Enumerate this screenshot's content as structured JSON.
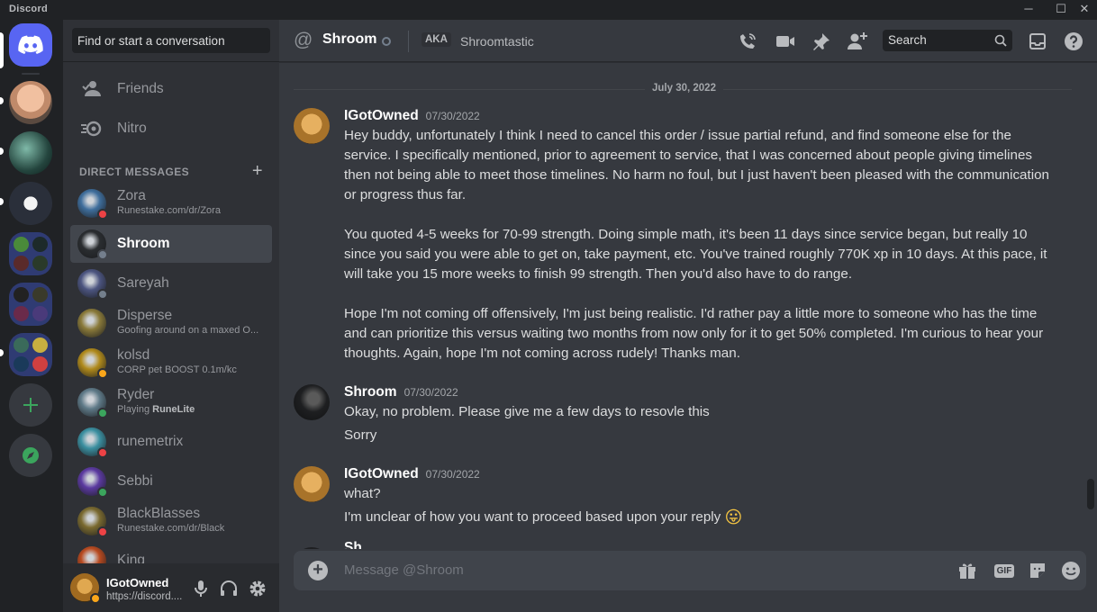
{
  "titlebar": {
    "brand": "Discord",
    "minimize": "─",
    "maximize": "☐",
    "close": "✕"
  },
  "sidebar": {
    "search_placeholder": "Find or start a conversation",
    "nav": [
      {
        "label": "Friends"
      },
      {
        "label": "Nitro"
      }
    ],
    "dm_header": "DIRECT MESSAGES",
    "dm_add": "+",
    "dms": [
      {
        "name": "Zora",
        "sub": "Runestake.com/dr/Zora",
        "status": "dnd",
        "color": "#3f6e9c"
      },
      {
        "name": "Shroom",
        "sub": "",
        "status": "offline",
        "color": "#2a2d30",
        "active": true
      },
      {
        "name": "Sareyah",
        "sub": "",
        "status": "offline",
        "color": "#4c5580"
      },
      {
        "name": "Disperse",
        "sub": "Goofing around on a maxed O...",
        "status": "none",
        "color": "#8a7a3a"
      },
      {
        "name": "kolsd",
        "sub": "CORP pet BOOST 0.1m/kc",
        "status": "idle",
        "color": "#b08a1c"
      },
      {
        "name": "Ryder",
        "sub_prefix": "Playing ",
        "sub_bold": "RuneLite",
        "status": "online",
        "color": "#5f7a88"
      },
      {
        "name": "runemetrix",
        "sub": "",
        "status": "dnd",
        "color": "#3b8fa0"
      },
      {
        "name": "Sebbi",
        "sub": "",
        "status": "online",
        "color": "#5b3aa0"
      },
      {
        "name": "BlackBlasses",
        "sub": "Runestake.com/dr/Black",
        "status": "dnd",
        "color": "#7a6a30"
      },
      {
        "name": "King",
        "sub": "",
        "status": "none",
        "color": "#b84a20"
      }
    ]
  },
  "user": {
    "name": "IGotOwned",
    "status_text": "https://discord...."
  },
  "header": {
    "channel": "Shroom",
    "aka": "AKA",
    "nickname": "Shroomtastic",
    "search_placeholder": "Search"
  },
  "messages": {
    "date": "July 30, 2022",
    "items": [
      {
        "author": "IGotOwned",
        "time": "07/30/2022",
        "paragraphs": [
          "Hey buddy, unfortunately I think I need to cancel this order / issue partial refund, and find someone else for the service. I specifically mentioned, prior to agreement to service, that I was concerned about people giving timelines then not being able to meet those timelines. No harm no foul, but I just haven't been pleased with the communication or progress thus far.",
          "You quoted 4-5 weeks for 70-99 strength. Doing simple math, it's been 11 days since service began, but really 10 since you said you were able to get on, take payment, etc. You've trained roughly 770K xp in 10 days. At this pace, it will take you 15 more weeks to finish 99 strength. Then you'd also have to do range.",
          "Hope I'm not coming off offensively, I'm just being realistic. I'd rather pay a little more to someone who has the time and can prioritize this versus waiting two months from now only for it to get 50% completed. I'm curious to hear your thoughts. Again, hope I'm not coming across rudely! Thanks man."
        ]
      },
      {
        "author": "Shroom",
        "time": "07/30/2022",
        "paragraphs": [
          "Okay, no problem. Please give me a few days to resovle this",
          "Sorry"
        ]
      },
      {
        "author": "IGotOwned",
        "time": "07/30/2022",
        "paragraphs": [
          "what?",
          "I'm unclear of how you want to proceed based upon your reply"
        ],
        "emoji": "😛"
      }
    ],
    "partial_author": "Sh"
  },
  "composer": {
    "placeholder": "Message @Shroom",
    "gif": "GIF"
  },
  "colors": {
    "accent": "#5865f2",
    "online": "#3ba55d",
    "idle": "#faa61a",
    "dnd": "#ed4245",
    "offline": "#747f8d"
  }
}
